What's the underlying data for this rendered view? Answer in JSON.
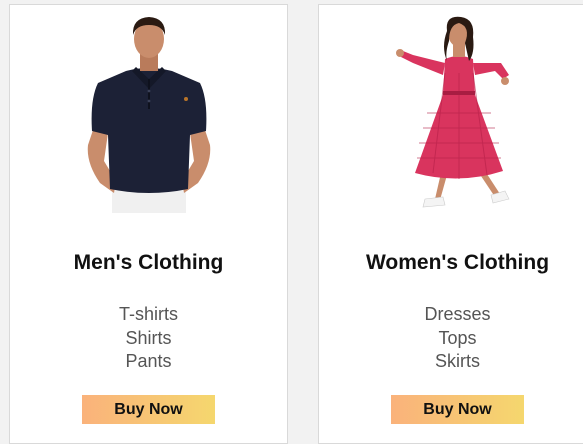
{
  "theme": {
    "page_background": "#f2f2f2",
    "card_background": "#ffffff",
    "button_gradient_start": "#fab27b",
    "button_gradient_end": "#f5d76e"
  },
  "cards": [
    {
      "image_icon": "man-in-navy-polo-photo-icon",
      "title": "Men's Clothing",
      "categories": [
        "T-shirts",
        "Shirts",
        "Pants"
      ],
      "button_label": "Buy Now"
    },
    {
      "image_icon": "woman-in-pink-dress-photo-icon",
      "title": "Women's Clothing",
      "categories": [
        "Dresses",
        "Tops",
        "Skirts"
      ],
      "button_label": "Buy Now"
    }
  ]
}
